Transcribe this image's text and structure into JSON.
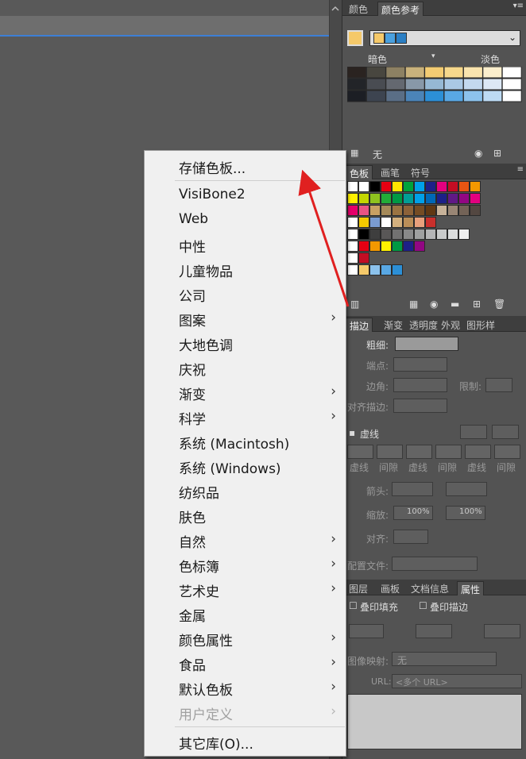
{
  "color_panel": {
    "tabs": [
      "颜色",
      "颜色参考"
    ],
    "dark_label": "暗色",
    "light_label": "淡色",
    "footer_label": "无",
    "base_color": "#f5c96a"
  },
  "swatches_panel": {
    "tabs": [
      "色板",
      "画笔",
      "符号"
    ]
  },
  "stroke_panel": {
    "tabs": [
      "描边",
      "渐变",
      "透明度",
      "外观",
      "图形样"
    ],
    "weight_label": "粗细:",
    "cap_label": "端点:",
    "corner_label": "边角:",
    "limit_label": "限制:",
    "align_label": "对齐描边:",
    "dashed_label": "虚线",
    "dash_labels": [
      "虚线",
      "间隙",
      "虚线",
      "间隙",
      "虚线",
      "间隙"
    ],
    "arrowheads_label": "箭头:",
    "scale_label": "缩放:",
    "scale_values": [
      "100%",
      "100%"
    ],
    "align2_label": "对齐:",
    "profile_label": "配置文件:"
  },
  "attributes_panel": {
    "tabs": [
      "图层",
      "画板",
      "文档信息",
      "属性"
    ],
    "overprint_fill": "叠印填充",
    "overprint_stroke": "叠印描边",
    "image_map_label": "图像映射:",
    "image_map_value": "无",
    "url_label": "URL:",
    "url_value": "<多个 URL>"
  },
  "menu": {
    "items": [
      {
        "label": "存储色板...",
        "submenu": false,
        "disabled": false
      },
      {
        "label": "VisiBone2",
        "submenu": false,
        "disabled": false
      },
      {
        "label": "Web",
        "submenu": false,
        "disabled": false
      },
      {
        "label": "中性",
        "submenu": false,
        "disabled": false
      },
      {
        "label": "儿童物品",
        "submenu": false,
        "disabled": false
      },
      {
        "label": "公司",
        "submenu": false,
        "disabled": false
      },
      {
        "label": "图案",
        "submenu": true,
        "disabled": false
      },
      {
        "label": "大地色调",
        "submenu": false,
        "disabled": false
      },
      {
        "label": "庆祝",
        "submenu": false,
        "disabled": false
      },
      {
        "label": "渐变",
        "submenu": true,
        "disabled": false
      },
      {
        "label": "科学",
        "submenu": true,
        "disabled": false
      },
      {
        "label": "系统 (Macintosh)",
        "submenu": false,
        "disabled": false
      },
      {
        "label": "系统 (Windows)",
        "submenu": false,
        "disabled": false
      },
      {
        "label": "纺织品",
        "submenu": false,
        "disabled": false
      },
      {
        "label": "肤色",
        "submenu": false,
        "disabled": false
      },
      {
        "label": "自然",
        "submenu": true,
        "disabled": false
      },
      {
        "label": "色标簿",
        "submenu": true,
        "disabled": false
      },
      {
        "label": "艺术史",
        "submenu": true,
        "disabled": false
      },
      {
        "label": "金属",
        "submenu": false,
        "disabled": false
      },
      {
        "label": "颜色属性",
        "submenu": true,
        "disabled": false
      },
      {
        "label": "食品",
        "submenu": true,
        "disabled": false
      },
      {
        "label": "默认色板",
        "submenu": true,
        "disabled": false
      },
      {
        "label": "用户定义",
        "submenu": true,
        "disabled": true
      },
      {
        "label": "其它库(O)...",
        "submenu": false,
        "disabled": false
      }
    ]
  },
  "colors": {
    "annotation_arrow": "#e02020",
    "accent_line": "#3d7fd6"
  }
}
